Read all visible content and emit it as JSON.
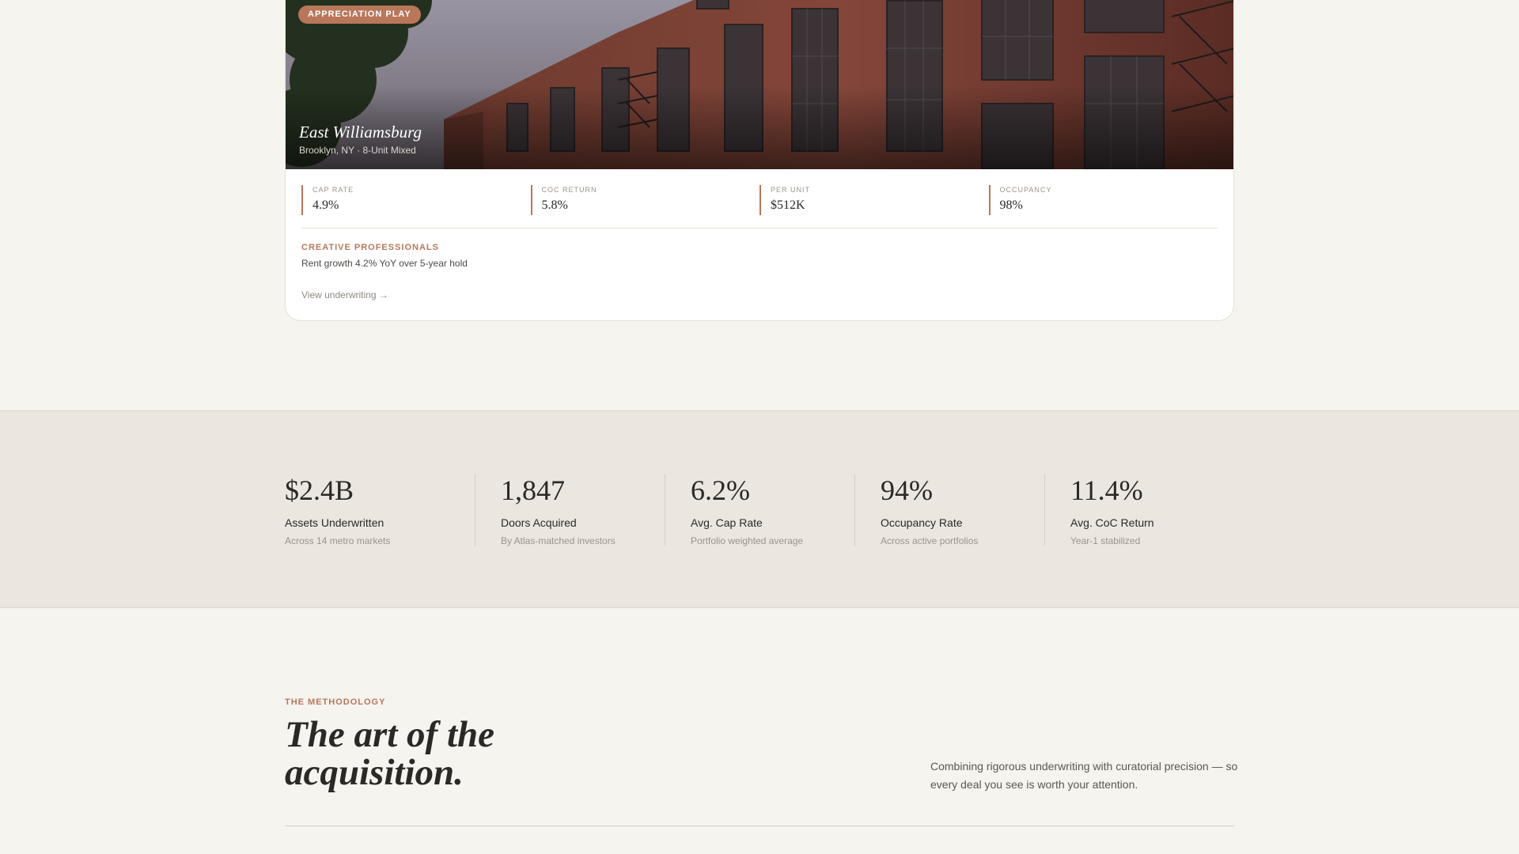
{
  "property": {
    "badge": "APPRECIATION PLAY",
    "name": "East Williamsburg",
    "location": "Brooklyn, NY · 8-Unit Mixed",
    "metrics": [
      {
        "label": "CAP RATE",
        "value": "4.9%"
      },
      {
        "label": "COC RETURN",
        "value": "5.8%"
      },
      {
        "label": "PER UNIT",
        "value": "$512K"
      },
      {
        "label": "OCCUPANCY",
        "value": "98%"
      }
    ],
    "tenant_profile": "CREATIVE PROFESSIONALS",
    "thesis": "Rent growth 4.2% YoY over 5-year hold",
    "link": "View underwriting →"
  },
  "stats": [
    {
      "value": "$2.4B",
      "label": "Assets Underwritten",
      "sub": "Across 14 metro markets"
    },
    {
      "value": "1,847",
      "label": "Doors Acquired",
      "sub": "By Atlas-matched investors"
    },
    {
      "value": "6.2%",
      "label": "Avg. Cap Rate",
      "sub": "Portfolio weighted average"
    },
    {
      "value": "94%",
      "label": "Occupancy Rate",
      "sub": "Across active portfolios"
    },
    {
      "value": "11.4%",
      "label": "Avg. CoC Return",
      "sub": "Year-1 stabilized"
    }
  ],
  "methodology": {
    "eyebrow": "THE METHODOLOGY",
    "title": "The art of the acquisition.",
    "intro": "Combining rigorous underwriting with curatorial precision — so every deal you see is worth your attention."
  },
  "colors": {
    "accent": "#b8775a",
    "background": "#f6f4ef",
    "band": "#ebe6df"
  }
}
